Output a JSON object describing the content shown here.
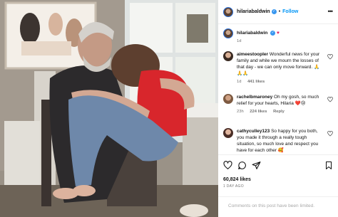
{
  "post": {
    "author": "hilariabaldwin",
    "follow_label": "Follow",
    "dot": "•",
    "caption_emoji": "♥",
    "caption_age": "1d"
  },
  "comments": [
    {
      "user": "aimeestoopler",
      "text": "Wonderful news for your family and while we mourn the losses of that day - we can only move forward. 🙏🙏🙏",
      "age": "1d",
      "likes": "441 likes",
      "reply": "",
      "avatar": "avatar-aimee"
    },
    {
      "user": "rachelbmaroney",
      "text": "Oh my gosh, so much relief for your hearts, Hilaria ❤️😢",
      "age": "23h",
      "likes": "224 likes",
      "reply": "Reply",
      "avatar": "avatar-rachel"
    },
    {
      "user": "cathyculley123",
      "text": "So happy for you both, you made it through a really tough situation, so much love and respect you have for each other 🥰",
      "age": "",
      "likes": "",
      "reply": "",
      "avatar": "avatar-cathy"
    }
  ],
  "engagement": {
    "likes": "60,824 likes",
    "date": "1 DAY AGO"
  },
  "comments_limited": "Comments on this post have been limited.",
  "icons": [
    "more-icon",
    "heart-icon",
    "comment-icon",
    "share-icon",
    "bookmark-icon",
    "verified-badge-icon"
  ],
  "colors": {
    "follow": "#0095f6",
    "verified": "#3897f0",
    "muted": "#737373",
    "caption_heart": "#e0245e"
  }
}
